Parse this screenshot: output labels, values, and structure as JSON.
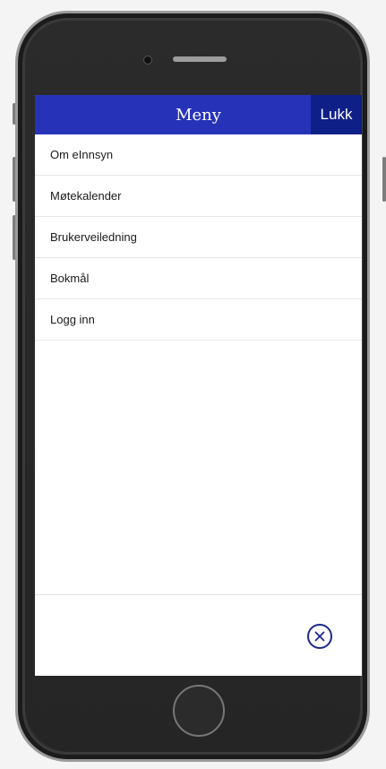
{
  "header": {
    "title": "Meny",
    "close_label": "Lukk"
  },
  "menu": {
    "items": [
      {
        "label": "Om eInnsyn"
      },
      {
        "label": "Møtekalender"
      },
      {
        "label": "Brukerveiledning"
      },
      {
        "label": "Bokmål"
      },
      {
        "label": "Logg inn"
      }
    ]
  },
  "footer": {
    "close_icon": "close-circle-icon"
  },
  "colors": {
    "header_bg": "#2633b8",
    "close_bg": "#0f1f88",
    "accent": "#1b2a8c"
  }
}
